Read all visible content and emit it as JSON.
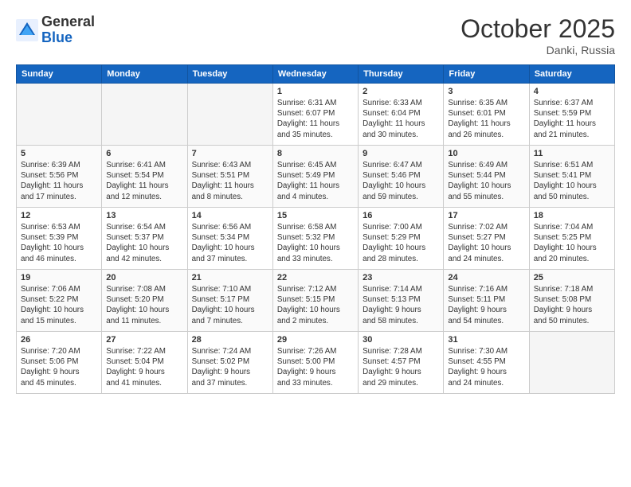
{
  "header": {
    "logo_general": "General",
    "logo_blue": "Blue",
    "month_title": "October 2025",
    "location": "Danki, Russia"
  },
  "weekdays": [
    "Sunday",
    "Monday",
    "Tuesday",
    "Wednesday",
    "Thursday",
    "Friday",
    "Saturday"
  ],
  "weeks": [
    [
      {
        "day": "",
        "info": ""
      },
      {
        "day": "",
        "info": ""
      },
      {
        "day": "",
        "info": ""
      },
      {
        "day": "1",
        "info": "Sunrise: 6:31 AM\nSunset: 6:07 PM\nDaylight: 11 hours\nand 35 minutes."
      },
      {
        "day": "2",
        "info": "Sunrise: 6:33 AM\nSunset: 6:04 PM\nDaylight: 11 hours\nand 30 minutes."
      },
      {
        "day": "3",
        "info": "Sunrise: 6:35 AM\nSunset: 6:01 PM\nDaylight: 11 hours\nand 26 minutes."
      },
      {
        "day": "4",
        "info": "Sunrise: 6:37 AM\nSunset: 5:59 PM\nDaylight: 11 hours\nand 21 minutes."
      }
    ],
    [
      {
        "day": "5",
        "info": "Sunrise: 6:39 AM\nSunset: 5:56 PM\nDaylight: 11 hours\nand 17 minutes."
      },
      {
        "day": "6",
        "info": "Sunrise: 6:41 AM\nSunset: 5:54 PM\nDaylight: 11 hours\nand 12 minutes."
      },
      {
        "day": "7",
        "info": "Sunrise: 6:43 AM\nSunset: 5:51 PM\nDaylight: 11 hours\nand 8 minutes."
      },
      {
        "day": "8",
        "info": "Sunrise: 6:45 AM\nSunset: 5:49 PM\nDaylight: 11 hours\nand 4 minutes."
      },
      {
        "day": "9",
        "info": "Sunrise: 6:47 AM\nSunset: 5:46 PM\nDaylight: 10 hours\nand 59 minutes."
      },
      {
        "day": "10",
        "info": "Sunrise: 6:49 AM\nSunset: 5:44 PM\nDaylight: 10 hours\nand 55 minutes."
      },
      {
        "day": "11",
        "info": "Sunrise: 6:51 AM\nSunset: 5:41 PM\nDaylight: 10 hours\nand 50 minutes."
      }
    ],
    [
      {
        "day": "12",
        "info": "Sunrise: 6:53 AM\nSunset: 5:39 PM\nDaylight: 10 hours\nand 46 minutes."
      },
      {
        "day": "13",
        "info": "Sunrise: 6:54 AM\nSunset: 5:37 PM\nDaylight: 10 hours\nand 42 minutes."
      },
      {
        "day": "14",
        "info": "Sunrise: 6:56 AM\nSunset: 5:34 PM\nDaylight: 10 hours\nand 37 minutes."
      },
      {
        "day": "15",
        "info": "Sunrise: 6:58 AM\nSunset: 5:32 PM\nDaylight: 10 hours\nand 33 minutes."
      },
      {
        "day": "16",
        "info": "Sunrise: 7:00 AM\nSunset: 5:29 PM\nDaylight: 10 hours\nand 28 minutes."
      },
      {
        "day": "17",
        "info": "Sunrise: 7:02 AM\nSunset: 5:27 PM\nDaylight: 10 hours\nand 24 minutes."
      },
      {
        "day": "18",
        "info": "Sunrise: 7:04 AM\nSunset: 5:25 PM\nDaylight: 10 hours\nand 20 minutes."
      }
    ],
    [
      {
        "day": "19",
        "info": "Sunrise: 7:06 AM\nSunset: 5:22 PM\nDaylight: 10 hours\nand 15 minutes."
      },
      {
        "day": "20",
        "info": "Sunrise: 7:08 AM\nSunset: 5:20 PM\nDaylight: 10 hours\nand 11 minutes."
      },
      {
        "day": "21",
        "info": "Sunrise: 7:10 AM\nSunset: 5:17 PM\nDaylight: 10 hours\nand 7 minutes."
      },
      {
        "day": "22",
        "info": "Sunrise: 7:12 AM\nSunset: 5:15 PM\nDaylight: 10 hours\nand 2 minutes."
      },
      {
        "day": "23",
        "info": "Sunrise: 7:14 AM\nSunset: 5:13 PM\nDaylight: 9 hours\nand 58 minutes."
      },
      {
        "day": "24",
        "info": "Sunrise: 7:16 AM\nSunset: 5:11 PM\nDaylight: 9 hours\nand 54 minutes."
      },
      {
        "day": "25",
        "info": "Sunrise: 7:18 AM\nSunset: 5:08 PM\nDaylight: 9 hours\nand 50 minutes."
      }
    ],
    [
      {
        "day": "26",
        "info": "Sunrise: 7:20 AM\nSunset: 5:06 PM\nDaylight: 9 hours\nand 45 minutes."
      },
      {
        "day": "27",
        "info": "Sunrise: 7:22 AM\nSunset: 5:04 PM\nDaylight: 9 hours\nand 41 minutes."
      },
      {
        "day": "28",
        "info": "Sunrise: 7:24 AM\nSunset: 5:02 PM\nDaylight: 9 hours\nand 37 minutes."
      },
      {
        "day": "29",
        "info": "Sunrise: 7:26 AM\nSunset: 5:00 PM\nDaylight: 9 hours\nand 33 minutes."
      },
      {
        "day": "30",
        "info": "Sunrise: 7:28 AM\nSunset: 4:57 PM\nDaylight: 9 hours\nand 29 minutes."
      },
      {
        "day": "31",
        "info": "Sunrise: 7:30 AM\nSunset: 4:55 PM\nDaylight: 9 hours\nand 24 minutes."
      },
      {
        "day": "",
        "info": ""
      }
    ]
  ]
}
